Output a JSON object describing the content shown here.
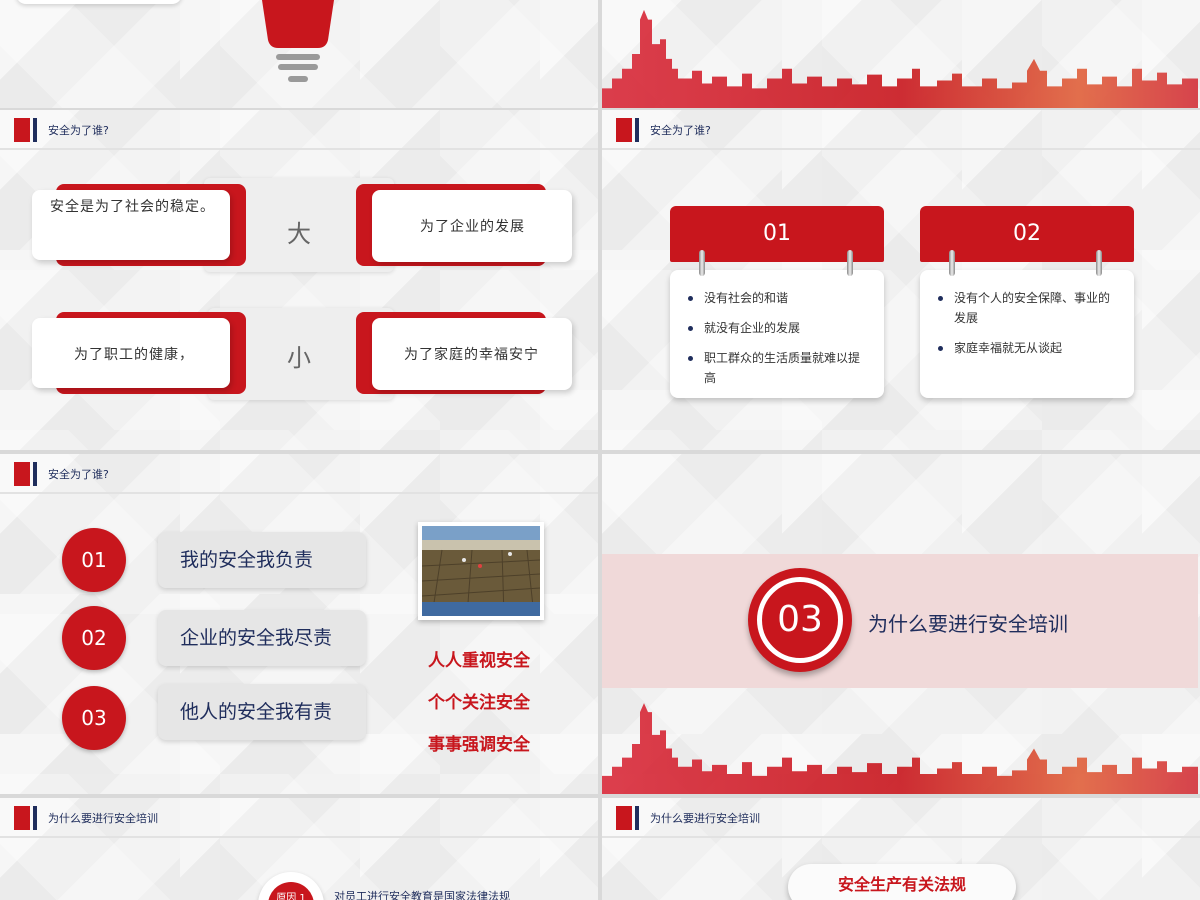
{
  "colors": {
    "red": "#c8161d",
    "navy": "#1f2d5c"
  },
  "header_title_who": "安全为了谁?",
  "header_title_why": "为什么要进行安全培训",
  "slide2": {
    "card1": "安全是为了社会的稳定。",
    "card2": "为了企业的发展",
    "card3": "为了职工的健康，",
    "card4": "为了家庭的幸福安宁",
    "big": "大",
    "small": "小"
  },
  "slide3": {
    "tab1": "01",
    "tab2": "02",
    "list1": [
      "没有社会的和谐",
      "就没有企业的发展",
      "职工群众的生活质量就难以提高"
    ],
    "list2": [
      "没有个人的安全保障、事业的发展",
      "家庭幸福就无从谈起"
    ]
  },
  "slide4": {
    "items": [
      {
        "num": "01",
        "text": "我的安全我负责"
      },
      {
        "num": "02",
        "text": "企业的安全我尽责"
      },
      {
        "num": "03",
        "text": "他人的安全我有责"
      }
    ],
    "slogans": [
      "人人重视安全",
      "个个关注安全",
      "事事强调安全"
    ]
  },
  "slide5": {
    "num": "03",
    "title": "为什么要进行安全培训"
  },
  "slide6": {
    "badge": "原因 1",
    "text": "对员工进行安全教育是国家法律法规"
  },
  "slide7": {
    "button": "安全生产有关法规"
  }
}
